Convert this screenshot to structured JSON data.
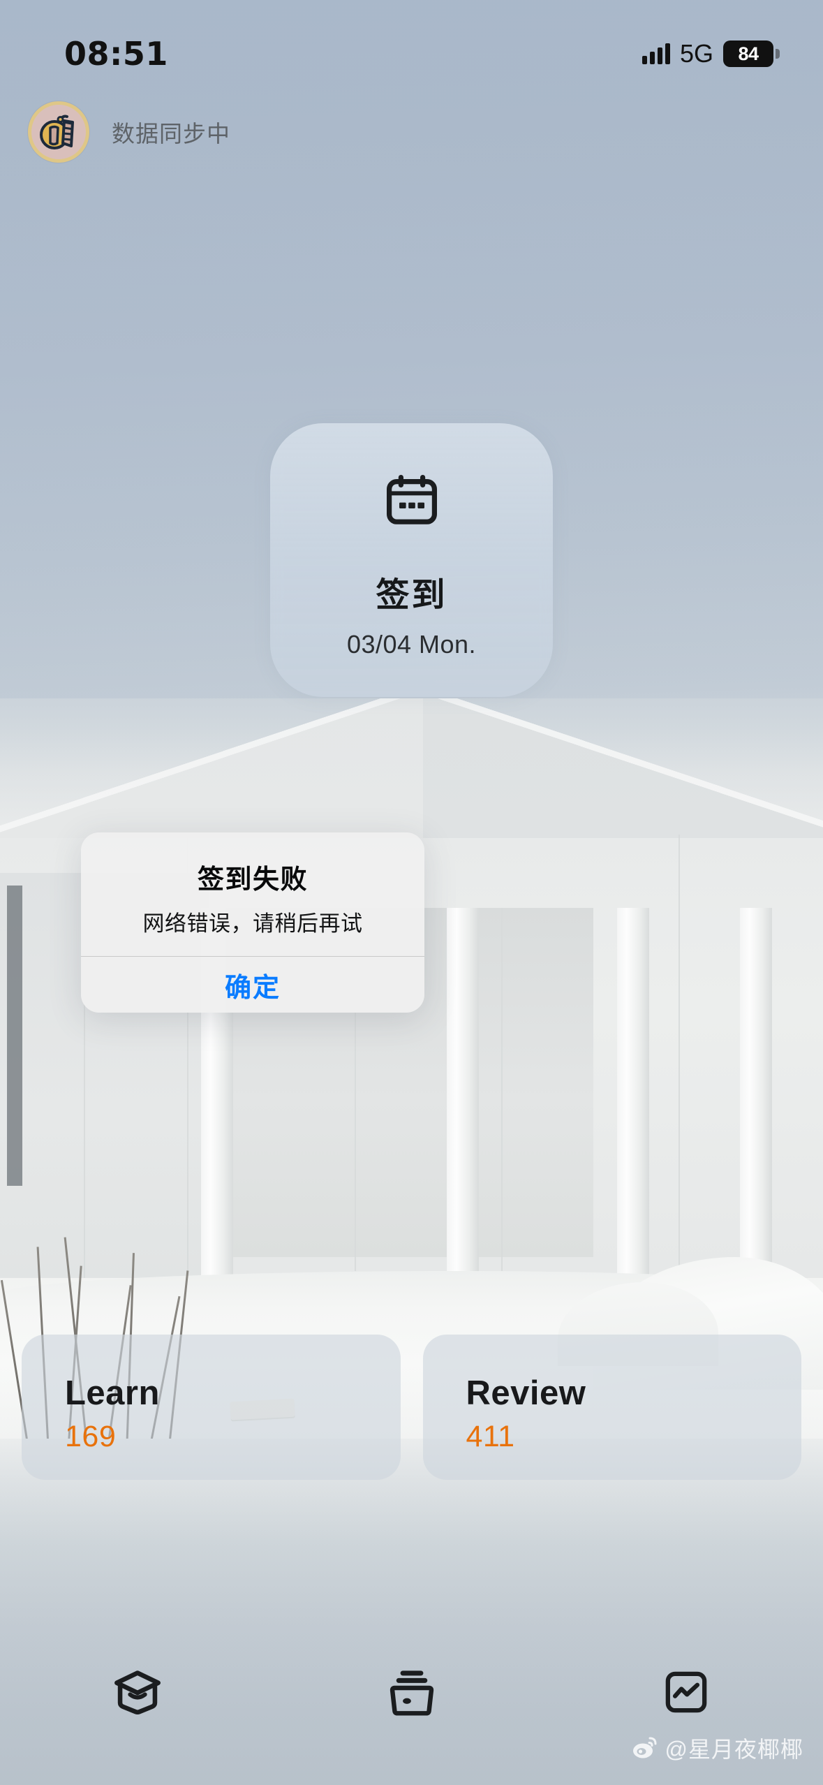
{
  "status_bar": {
    "time": "08:51",
    "network": "5G",
    "battery_level": "84",
    "signal_icon": "signal-bars-icon",
    "battery_icon": "battery-icon"
  },
  "sync": {
    "avatar_icon": "user-avatar-icon",
    "label": "数据同步中"
  },
  "checkin_card": {
    "icon": "calendar-icon",
    "title": "签到",
    "date": "03/04 Mon."
  },
  "alert": {
    "title": "签到失败",
    "message": "网络错误，请稍后再试",
    "confirm_label": "确定",
    "confirm_color": "#0a7cff"
  },
  "stats": [
    {
      "label": "Learn",
      "value": "169"
    },
    {
      "label": "Review",
      "value": "411"
    }
  ],
  "tab_bar": [
    {
      "icon": "graduation-cap-icon",
      "name": "study"
    },
    {
      "icon": "card-box-icon",
      "name": "decks"
    },
    {
      "icon": "statistics-chart-icon",
      "name": "stats"
    }
  ],
  "watermark": {
    "icon": "weibo-icon",
    "text": "@星月夜椰椰"
  },
  "colors": {
    "accent_orange": "#e8720c",
    "link_blue": "#0a7cff",
    "sky": "#b0bccb"
  }
}
